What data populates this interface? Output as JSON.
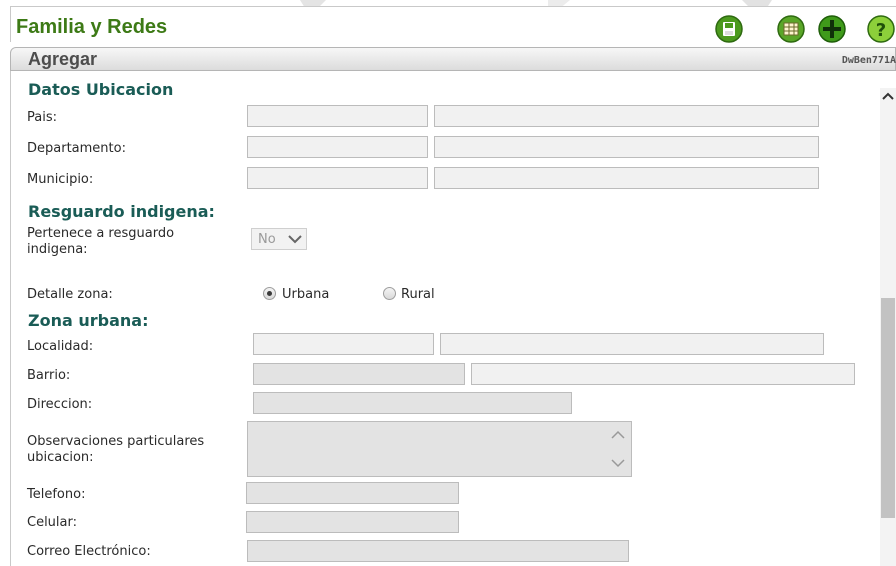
{
  "app": {
    "title": "Familia y Redes"
  },
  "toolbar": {
    "icons": [
      "save-icon",
      "grid-icon",
      "add-icon",
      "help-icon"
    ],
    "colors": {
      "accent": "#3d7a16",
      "section": "#1a5c56"
    }
  },
  "subheader": {
    "title": "Agregar",
    "form_code": "DwBen771A"
  },
  "sections": {
    "ubicacion": "Datos Ubicacion",
    "resguardo": "Resguardo indigena:",
    "zona": "Zona urbana:"
  },
  "labels": {
    "pais": "Pais:",
    "departamento": "Departamento:",
    "municipio": "Municipio:",
    "pertenece": "Pertenece a resguardo indigena:",
    "detalle_zona": "Detalle zona:",
    "localidad": "Localidad:",
    "barrio": "Barrio:",
    "direccion": "Direccion:",
    "observaciones": "Observaciones particulares ubicacion:",
    "telefono": "Telefono:",
    "celular": "Celular:",
    "correo": "Correo Electrónico:"
  },
  "fields": {
    "resguardo_select": {
      "value": "No"
    },
    "zona": {
      "options": [
        "Urbana",
        "Rural"
      ],
      "selected": "Urbana"
    }
  }
}
